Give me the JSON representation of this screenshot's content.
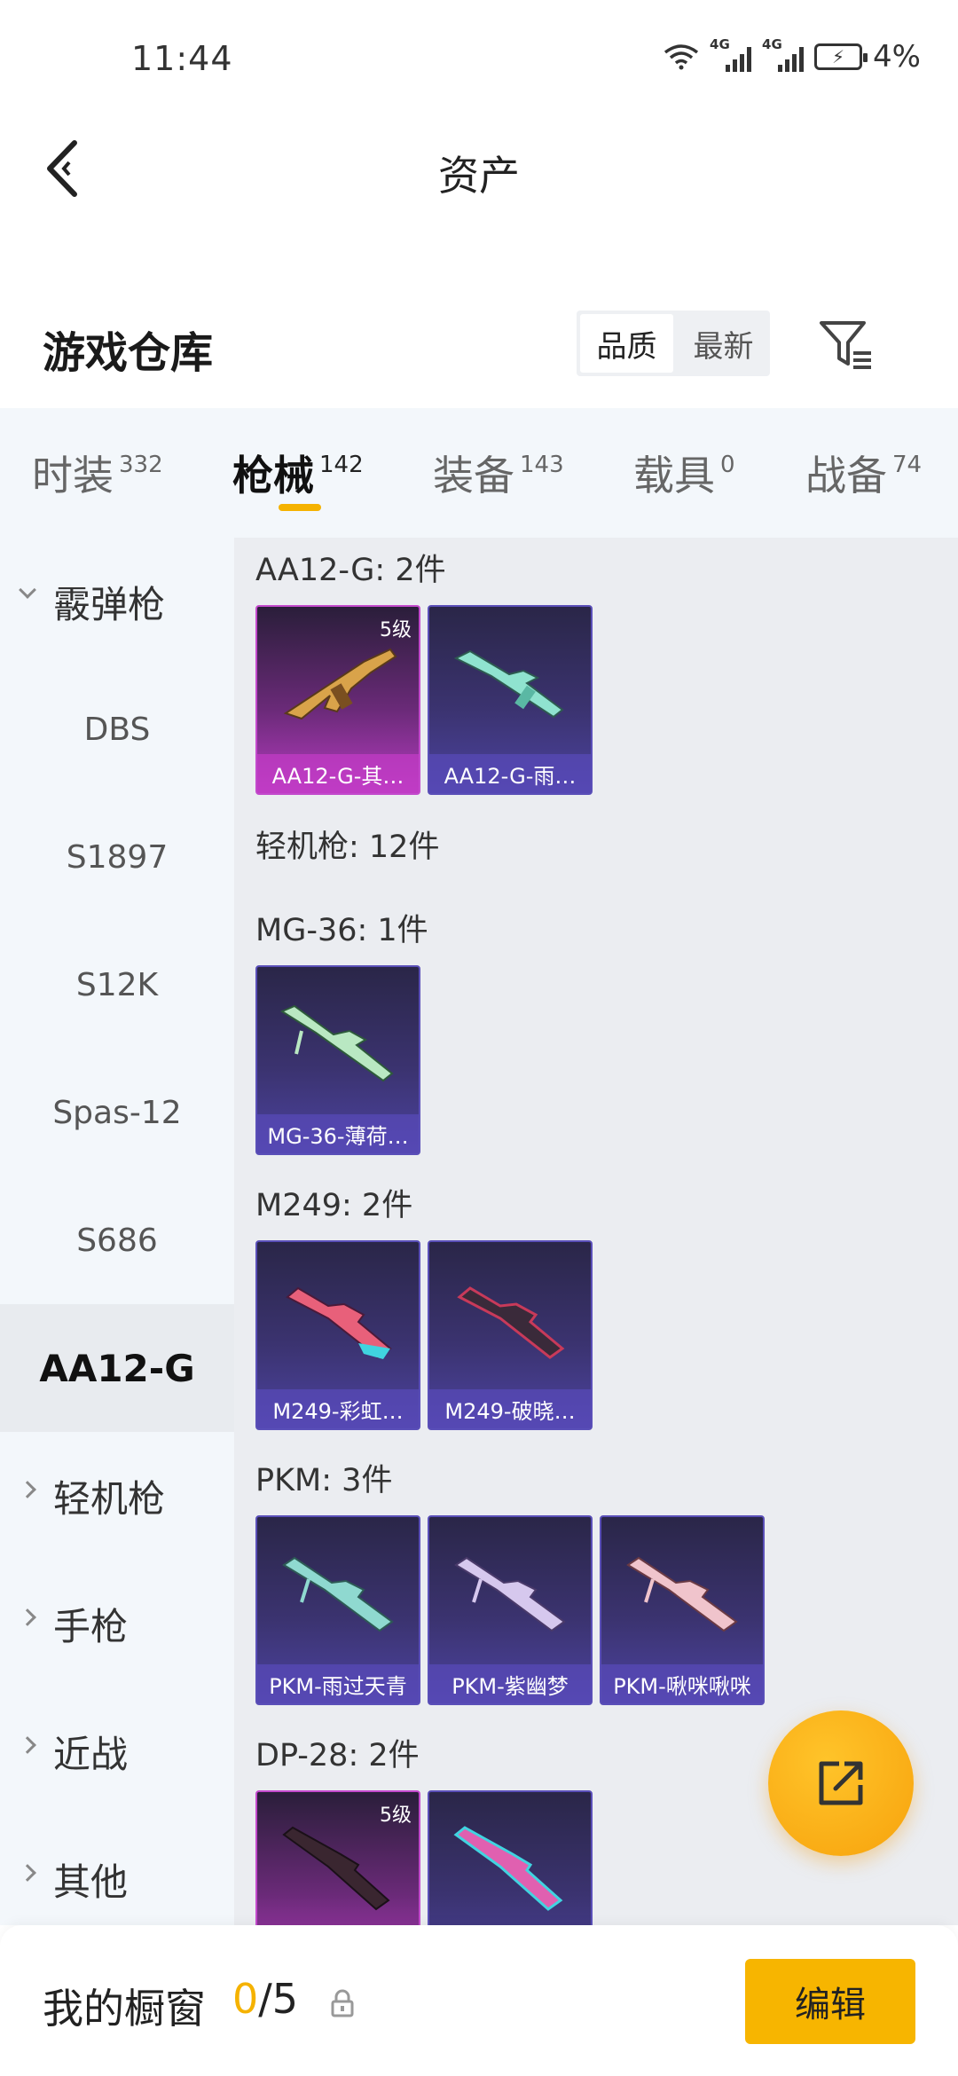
{
  "status_bar": {
    "time": "11:44",
    "network_1": "4G",
    "network_2": "4G",
    "battery_percent": "4%"
  },
  "header": {
    "title": "资产",
    "back_icon": "chevron-left-icon"
  },
  "warehouse": {
    "title": "游戏仓库",
    "sort_options": [
      "品质",
      "最新"
    ],
    "sort_selected": "品质",
    "filter_icon": "filter-icon"
  },
  "tabs": [
    {
      "label": "时装",
      "count": "332"
    },
    {
      "label": "枪械",
      "count": "142",
      "active": true
    },
    {
      "label": "装备",
      "count": "143"
    },
    {
      "label": "载具",
      "count": "0"
    },
    {
      "label": "战备",
      "count": "74"
    }
  ],
  "sidebar": {
    "groups": [
      {
        "label": "霰弹枪",
        "expanded": true,
        "items": [
          "DBS",
          "S1897",
          "S12K",
          "Spas-12",
          "S686",
          "AA12-G"
        ],
        "selected": "AA12-G"
      },
      {
        "label": "轻机枪",
        "expanded": false
      },
      {
        "label": "手枪",
        "expanded": false
      },
      {
        "label": "近战",
        "expanded": false
      },
      {
        "label": "其他",
        "expanded": false
      }
    ]
  },
  "content": {
    "sections": [
      {
        "title": "AA12-G: 2件",
        "cards": [
          {
            "label": "AA12-G-其…",
            "level": "5级",
            "rarity": "legendary"
          },
          {
            "label": "AA12-G-雨…",
            "rarity": "epic"
          }
        ]
      },
      {
        "title": "轻机枪: 12件",
        "cards": []
      },
      {
        "title": "MG-36: 1件",
        "cards": [
          {
            "label": "MG-36-薄荷…",
            "rarity": "epic"
          }
        ]
      },
      {
        "title": "M249: 2件",
        "cards": [
          {
            "label": "M249-彩虹…",
            "rarity": "epic"
          },
          {
            "label": "M249-破晓…",
            "rarity": "epic"
          }
        ]
      },
      {
        "title": "PKM: 3件",
        "cards": [
          {
            "label": "PKM-雨过天青",
            "rarity": "epic"
          },
          {
            "label": "PKM-紫幽梦",
            "rarity": "epic"
          },
          {
            "label": "PKM-啾咪啾咪",
            "rarity": "epic"
          }
        ]
      },
      {
        "title": "DP-28: 2件",
        "cards": [
          {
            "label": "",
            "level": "5级",
            "rarity": "legendary"
          },
          {
            "label": "",
            "rarity": "epic"
          }
        ]
      }
    ]
  },
  "fab": {
    "icon": "share-icon"
  },
  "bottom_bar": {
    "label": "我的橱窗",
    "count_current": "0",
    "count_total": "/5",
    "lock_icon": "lock-icon",
    "edit_label": "编辑"
  },
  "colors": {
    "accent": "#f5b200",
    "card_epic": "#4c43a0",
    "card_legendary": "#b63cc0",
    "sidebar_bg": "#f3f7fb",
    "content_bg": "#ebedf1"
  }
}
